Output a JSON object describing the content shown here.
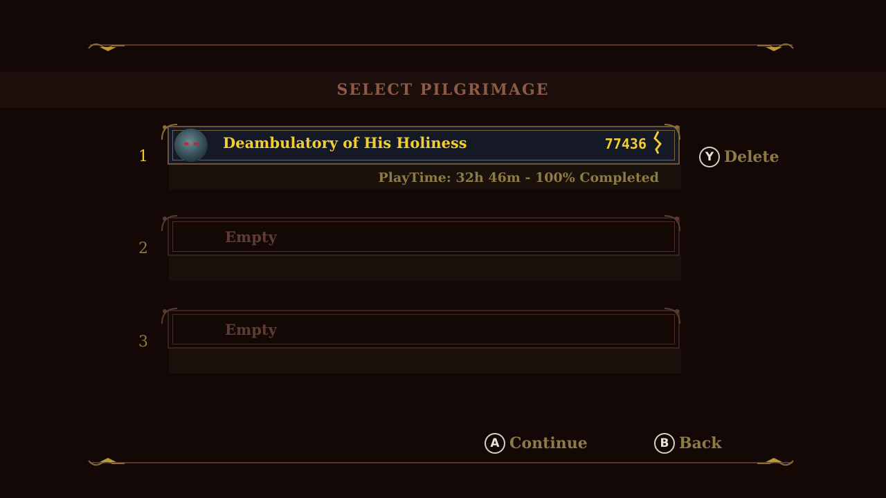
{
  "screen": {
    "title": "SELECT PILGRIMAGE"
  },
  "slots": [
    {
      "number": "1",
      "name": "Deambulatory of His Holiness",
      "tears": "77436",
      "playtime": "PlayTime: 32h 46m - 100% Completed",
      "selected": true
    },
    {
      "number": "2",
      "name": "Empty"
    },
    {
      "number": "3",
      "name": "Empty"
    }
  ],
  "actions": {
    "delete": {
      "button": "Y",
      "label": "Delete"
    },
    "continue": {
      "button": "A",
      "label": "Continue"
    },
    "back": {
      "button": "B",
      "label": "Back"
    }
  },
  "colors": {
    "background": "#130806",
    "accent_gold": "#f1cf30",
    "muted_gold": "#8d7b43",
    "title": "#8e5a48",
    "empty_text": "#5e3c33"
  },
  "icons": {
    "avatar": "penitent-portrait-icon",
    "currency": "tears-of-atonement-icon"
  }
}
